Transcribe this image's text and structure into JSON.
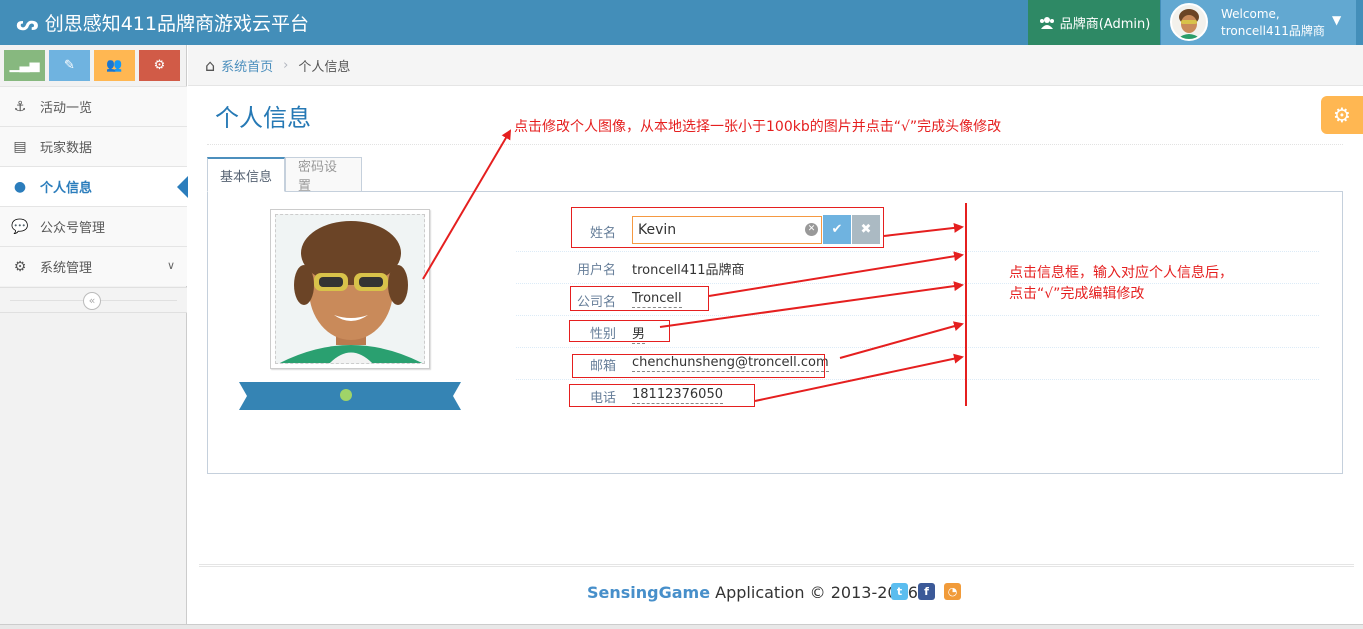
{
  "app": {
    "title": "创思感知411品牌商游戏云平台"
  },
  "navbar": {
    "role_label": "品牌商(Admin)",
    "welcome": "Welcome,",
    "user_name": "troncell411品牌商"
  },
  "sidebar": {
    "shortcuts": [
      {
        "icon": "signal-icon",
        "color": "#87b87f"
      },
      {
        "icon": "pencil-icon",
        "color": "#6fb3e0"
      },
      {
        "icon": "users-icon",
        "color": "#ffb752"
      },
      {
        "icon": "cogs-icon",
        "color": "#d15b47"
      }
    ],
    "items": [
      {
        "label": "活动一览",
        "icon": "anchor-icon"
      },
      {
        "label": "玩家数据",
        "icon": "archive-icon"
      },
      {
        "label": "个人信息",
        "icon": "user-icon",
        "active": true
      },
      {
        "label": "公众号管理",
        "icon": "wechat-icon"
      },
      {
        "label": "系统管理",
        "icon": "cog-icon"
      }
    ]
  },
  "breadcrumb": {
    "home": "系统首页",
    "current": "个人信息"
  },
  "page": {
    "title": "个人信息"
  },
  "tabs": [
    {
      "label": "基本信息",
      "active": true
    },
    {
      "label": "密码设置"
    }
  ],
  "profile": {
    "fields": [
      {
        "label": "姓名",
        "value": "Kevin",
        "editing": true
      },
      {
        "label": "用户名",
        "value": "troncell411品牌商"
      },
      {
        "label": "公司名",
        "value": "Troncell"
      },
      {
        "label": "性别",
        "value": "男"
      },
      {
        "label": "邮箱",
        "value": "chenchunsheng@troncell.com"
      },
      {
        "label": "电话",
        "value": "18112376050"
      }
    ]
  },
  "annotations": {
    "avatar_note": "点击修改个人图像，从本地选择一张小于100kb的图片并点击“√”完成头像修改",
    "info_note_line1": "点击信息框，输入对应个人信息后，",
    "info_note_line2": "点击“√”完成编辑修改"
  },
  "footer": {
    "brand": "SensingGame",
    "text": " Application © 2013-2016",
    "social": [
      {
        "icon": "twitter-icon",
        "color": "#5bbdef"
      },
      {
        "icon": "facebook-icon",
        "color": "#3b5998"
      },
      {
        "icon": "rss-icon",
        "color": "#f19b3a"
      }
    ]
  }
}
